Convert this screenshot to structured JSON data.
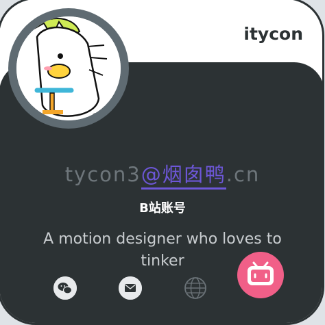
{
  "profile": {
    "username": "itycon",
    "domain_prefix": "tycon3",
    "domain_middle": "@烟囱鸭",
    "domain_suffix": ".cn",
    "account_label": "B站账号",
    "bio": "A motion designer who loves to tinker"
  },
  "icons": [
    "wechat-icon",
    "mail-icon",
    "globe-icon",
    "bilibili-icon",
    "avatar-image"
  ],
  "colors": {
    "panel": "#2c3234",
    "accent": "#6d57d8",
    "bilibili": "#f15f88"
  }
}
